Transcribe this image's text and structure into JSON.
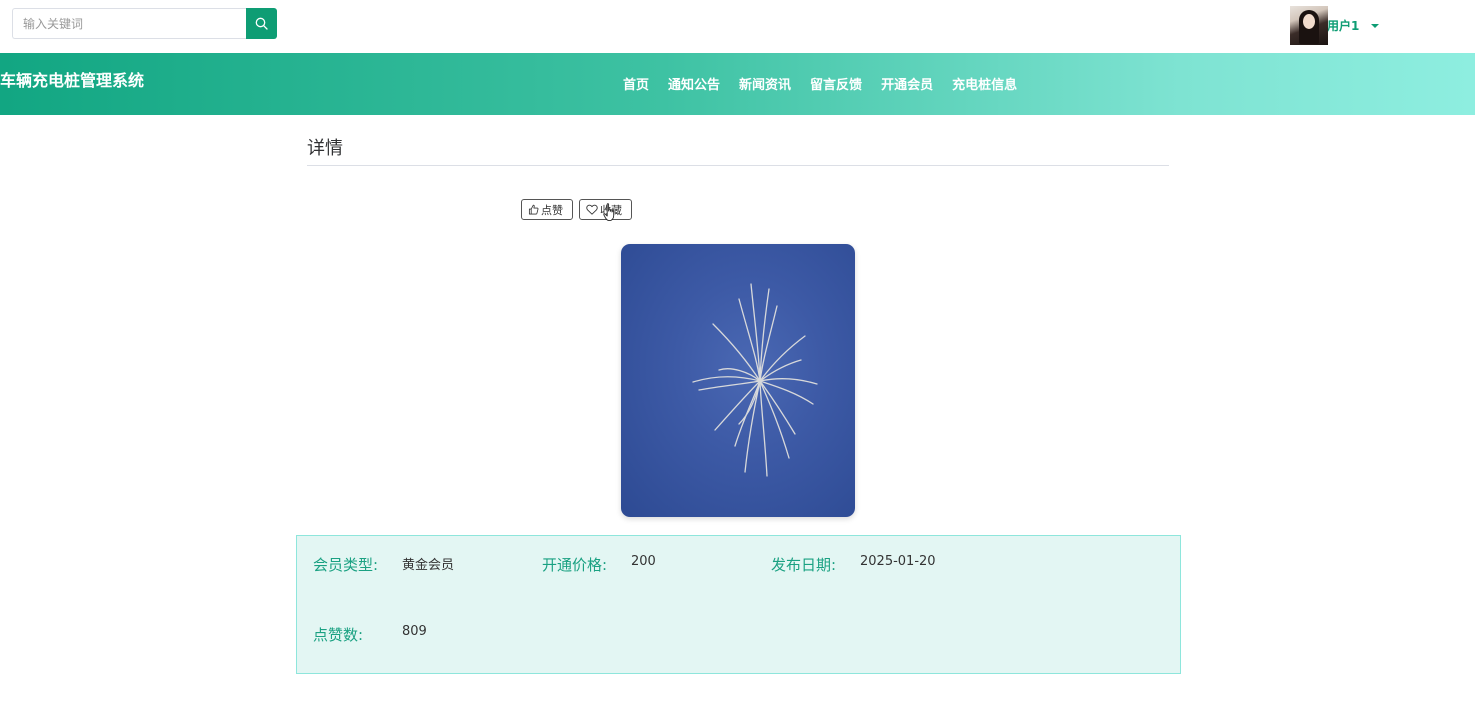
{
  "search": {
    "placeholder": "输入关键词",
    "icon": "search-icon"
  },
  "user": {
    "name": "用户1",
    "avatar_icon": "avatar-image"
  },
  "site": {
    "title": "车辆充电桩管理系统"
  },
  "nav": {
    "items": [
      {
        "label": "首页"
      },
      {
        "label": "通知公告"
      },
      {
        "label": "新闻资讯"
      },
      {
        "label": "留言反馈"
      },
      {
        "label": "开通会员"
      },
      {
        "label": "充电桩信息"
      }
    ]
  },
  "detail": {
    "title": "详情",
    "like_label": "点赞",
    "favorite_label": "收藏",
    "fields": {
      "member_type": {
        "label": "会员类型:",
        "value": "黄金会员"
      },
      "price": {
        "label": "开通价格:",
        "value": "200"
      },
      "publish_date": {
        "label": "发布日期:",
        "value": "2025-01-20"
      },
      "likes": {
        "label": "点赞数:",
        "value": "809"
      }
    }
  },
  "colors": {
    "accent": "#0e9d74",
    "header_start": "#12a682",
    "header_end": "#8eeee0",
    "info_bg": "#e3f6f3",
    "info_label": "#1aa182"
  }
}
